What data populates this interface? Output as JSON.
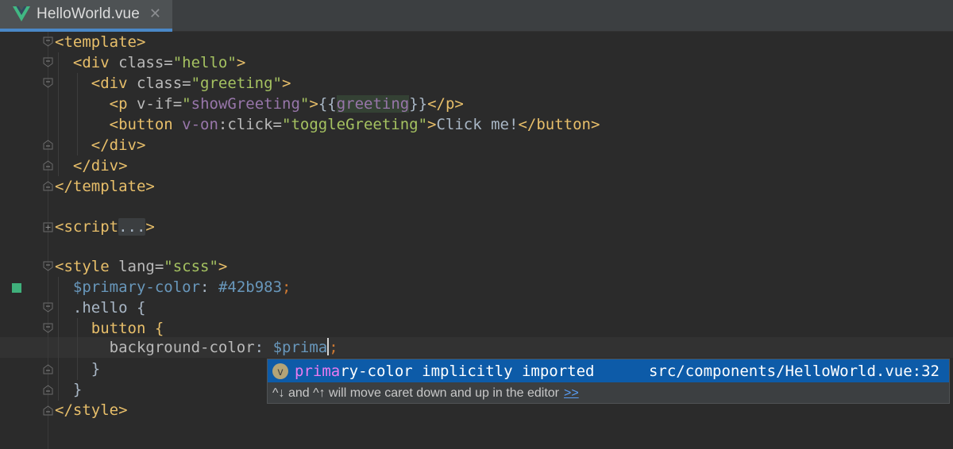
{
  "tab": {
    "title": "HelloWorld.vue",
    "icon": "vue-logo-icon",
    "close_icon": "close-icon"
  },
  "code": {
    "l1_tag_open": "<template>",
    "l2_open": "<div ",
    "l2_attr": "class=",
    "l2_val": "\"hello\"",
    "l2_close": ">",
    "l3_open": "<div ",
    "l3_attr": "class=",
    "l3_val": "\"greeting\"",
    "l3_close": ">",
    "l4_open": "<p ",
    "l4_attr": "v-if=",
    "l4_val_q1": "\"",
    "l4_val": "showGreeting",
    "l4_val_q2": "\"",
    "l4_gt": ">",
    "l4_mu_open": "{{",
    "l4_mu_var": "greeting",
    "l4_mu_close": "}}",
    "l4_end": "</p>",
    "l5_open": "<button ",
    "l5_attr_dir": "v-on",
    "l5_attr_rest": ":click=",
    "l5_val": "\"toggleGreeting\"",
    "l5_gt": ">",
    "l5_text": "Click me!",
    "l5_end": "</button>",
    "l6": "</div>",
    "l7": "</div>",
    "l8": "</template>",
    "l10_tag": "<script",
    "l10_fold": "...",
    "l10_gt": ">",
    "l12_open": "<style ",
    "l12_attr": "lang=",
    "l12_val": "\"scss\"",
    "l12_gt": ">",
    "l13_var": "$primary-color",
    "l13_colon": ": ",
    "l13_hex": "#42b983",
    "l13_semi": ";",
    "l14": ".hello {",
    "l15": "button {",
    "l16_prop": "background-color",
    "l16_colon": ": ",
    "l16_var": "$prima",
    "l16_semi": ";",
    "l17": "}",
    "l18": "}",
    "l19": "</style>"
  },
  "popup": {
    "badge": "v",
    "match": "prima",
    "rest": "ry-color implicitly imported",
    "location": "src/components/HelloWorld.vue:32",
    "hint": "^↓ and ^↑ will move caret down and up in the editor",
    "hint_link": ">>"
  },
  "colors": {
    "background": "#2b2b2b",
    "selection": "#0d5ba8",
    "tag": "#e8bf6a",
    "string": "#a5c261",
    "variable": "#6897bb",
    "change_marker": "#3fb07b"
  }
}
